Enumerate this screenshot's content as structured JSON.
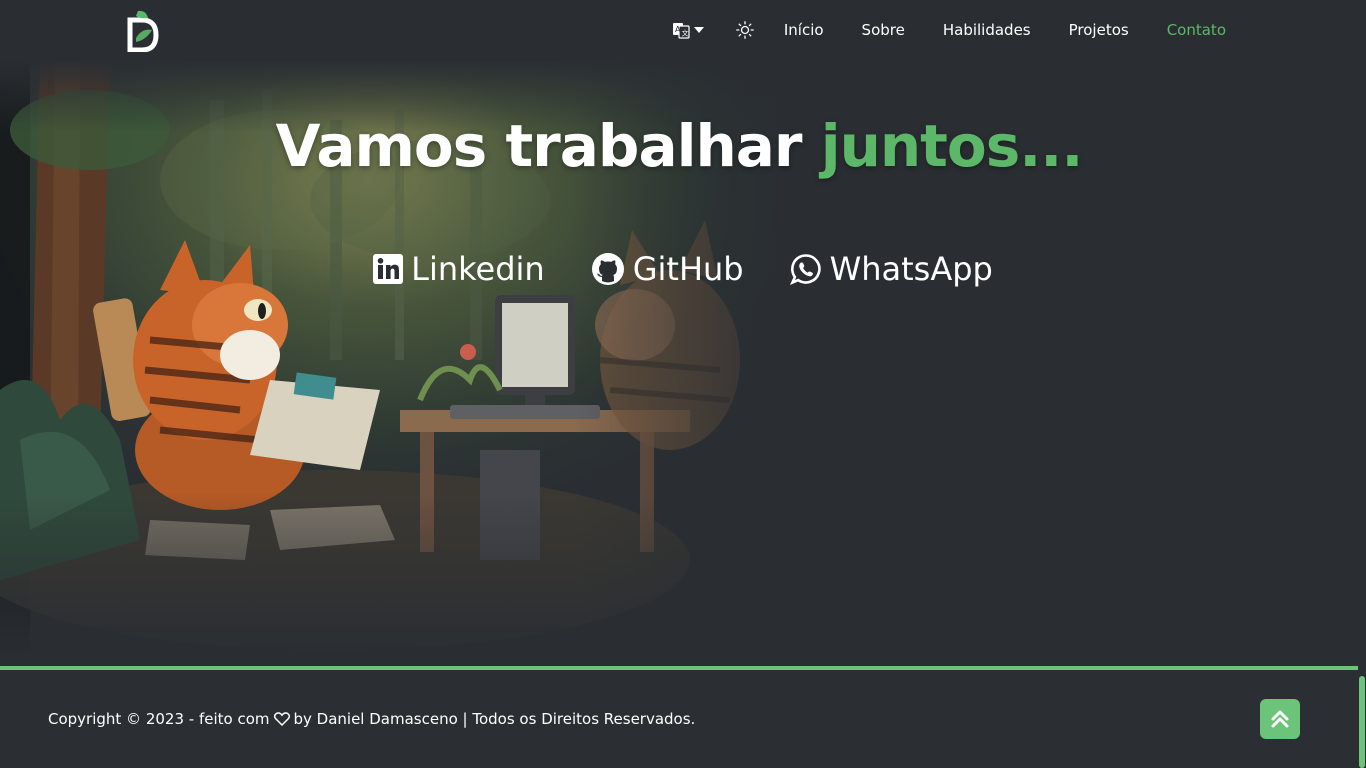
{
  "header": {
    "nav": {
      "home": "Início",
      "about": "Sobre",
      "skills": "Habilidades",
      "projects": "Projetos",
      "contact": "Contato"
    }
  },
  "hero": {
    "title_main": "Vamos trabalhar ",
    "title_accent": "juntos..."
  },
  "socials": [
    {
      "label": "Linkedin",
      "icon": "linkedin-icon"
    },
    {
      "label": "GitHub",
      "icon": "github-icon"
    },
    {
      "label": "WhatsApp",
      "icon": "whatsapp-icon"
    }
  ],
  "footer": {
    "copyright_before": "Copyright © 2023 - feito com",
    "copyright_after": "by Daniel Damasceno | Todos os Direitos Reservados."
  },
  "colors": {
    "accent": "#5cb868",
    "background": "#2a2e33"
  }
}
